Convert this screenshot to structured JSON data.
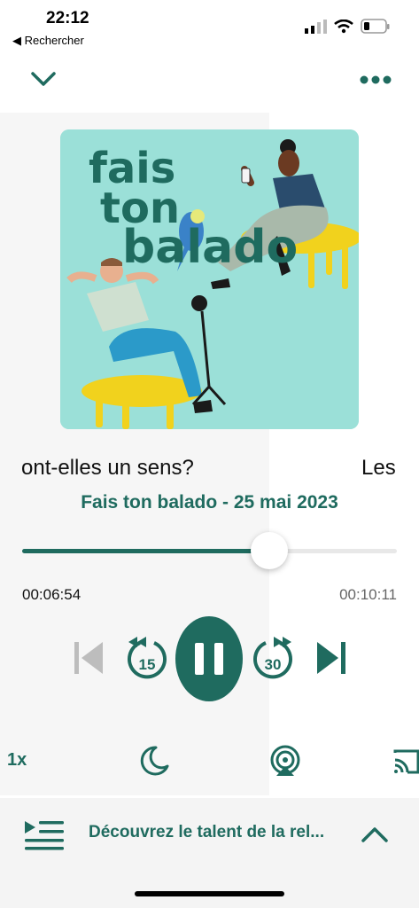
{
  "status_bar": {
    "time": "22:12",
    "back_label": "◀ Rechercher"
  },
  "episode": {
    "title_part1": "ont-elles un sens?",
    "title_part2": "Les",
    "subtitle": "Fais ton balado - 25 mai 2023",
    "artwork_text": [
      "fais",
      "ton",
      "balado"
    ]
  },
  "progress": {
    "elapsed": "00:06:54",
    "remaining": "00:10:11",
    "fraction": 0.66
  },
  "controls": {
    "skip_back": "15",
    "skip_forward": "30",
    "speed": "1x"
  },
  "up_next": {
    "label": "Découvrez le talent de la rel..."
  },
  "colors": {
    "accent": "#1f6b5f",
    "artwork_bg": "#9be0d8",
    "yellow": "#f1d21d"
  }
}
